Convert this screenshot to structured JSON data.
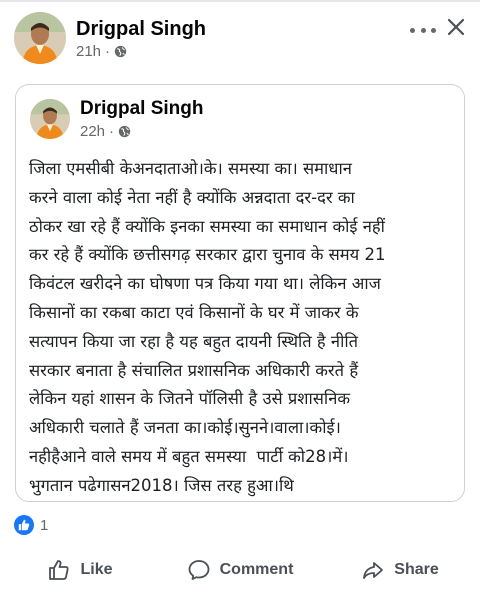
{
  "post": {
    "author": "Drigpal Singh",
    "time": "21h",
    "separator": "·",
    "privacy_icon": "globe-icon",
    "more_icon": "more-icon",
    "close_icon": "close-icon"
  },
  "shared": {
    "author": "Drigpal Singh",
    "time": "22h",
    "separator": "·",
    "privacy_icon": "globe-icon",
    "text": "जिला एमसीबी केअनदाताओ।के। समस्या का। समाधान\nकरने वाला कोई नेता नहीं है क्योंकि अन्नदाता दर-दर का\nठोकर खा रहे हैं क्योंकि इनका समस्या का समाधान कोई नहीं\nकर रहे हैं क्योंकि छत्तीसगढ़ सरकार द्वारा चुनाव के समय 21\nकिवंटल खरीदने का घोषणा पत्र किया गया था। लेकिन आज\nकिसानों का रकबा काटा एवं किसानों के घर में जाकर के\nसत्यापन किया जा रहा है यह बहुत दायनी स्थिति है नीति\nसरकार बनाता है संचालित प्रशासनिक अधिकारी करते हैं\nलेकिन यहां शासन के जितने पॉलिसी है उसे प्रशासनिक\nअधिकारी चलाते हैं जनता का।कोई।सुनने।वाला।कोई।\nनहीहैआने वाले समय में बहुत समस्या  पार्टी को28।में।\nभुगतान पढेगासन2018। जिस तरह हुआ।थि"
  },
  "reactions": {
    "icon": "like-reaction-icon",
    "count": "1"
  },
  "actions": {
    "like_label": "Like",
    "comment_label": "Comment",
    "share_label": "Share"
  },
  "colors": {
    "accent": "#1877f2",
    "secondary_text": "#65676b",
    "border": "#cdd0d5"
  }
}
